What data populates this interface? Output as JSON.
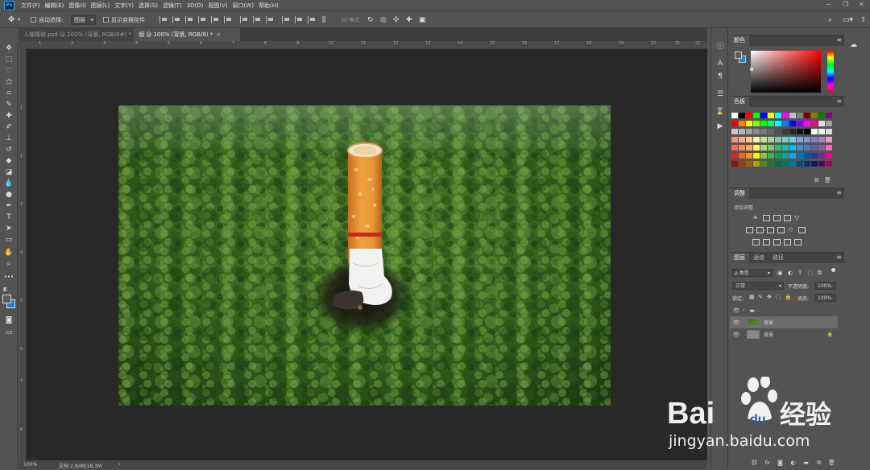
{
  "menubar": {
    "app_icon": "Ps",
    "items": [
      "文件(F)",
      "编辑(E)",
      "图像(I)",
      "图层(L)",
      "文字(Y)",
      "选择(S)",
      "滤镜(T)",
      "3D(D)",
      "视图(V)",
      "窗口(W)",
      "帮助(H)"
    ]
  },
  "options": {
    "auto_select_label": "自动选择:",
    "auto_select_value": "图层",
    "show_transform_label": "显示变换控件",
    "mode_3d_label": "3D 模式:"
  },
  "tabs": [
    {
      "label": "人像精修.psd @ 100% (背景, RGB/8#) *",
      "active": false
    },
    {
      "label": "烟 @ 100% (背景, RGB/8) *",
      "active": true
    }
  ],
  "ruler": {
    "top_numbers": [
      "1",
      "2",
      "3",
      "4",
      "5",
      "6",
      "7",
      "8",
      "9",
      "10",
      "11",
      "12",
      "13",
      "14",
      "15",
      "16",
      "17",
      "18",
      "19",
      "20",
      "21",
      "22"
    ],
    "left_numbers": [
      "1",
      "2",
      "3",
      "4",
      "5",
      "6",
      "7",
      "8"
    ]
  },
  "status": {
    "zoom": "100%",
    "doc": "文档:2.84M/18.3M"
  },
  "panels": {
    "color_title": "颜色",
    "swatches_title": "色板",
    "adjust_title": "调整",
    "adjust_subtitle": "添加调整",
    "layers_tabs": [
      "图层",
      "通道",
      "路径"
    ],
    "kind_label": "ρ 类型",
    "blend_mode": "正常",
    "opacity_label": "不透明度:",
    "opacity_value": "100%",
    "lock_label": "锁定:",
    "fill_label": "填充:",
    "fill_value": "100%",
    "layers": [
      {
        "name": "",
        "type": "group",
        "selected": false
      },
      {
        "name": "背景",
        "type": "image",
        "selected": true
      },
      {
        "name": "背景",
        "type": "background",
        "selected": false
      }
    ]
  },
  "watermark": {
    "brand": "Bai",
    "brand2": "du",
    "product": "经验",
    "url": "jingyan.baidu.com"
  },
  "colors": {
    "forest": "#2f5a1d",
    "forest_light": "#5d8a35",
    "filter_tip": "#e8952e",
    "foreground_swatch": "#5b5b5b",
    "background_swatch": "#1e7fd6"
  }
}
